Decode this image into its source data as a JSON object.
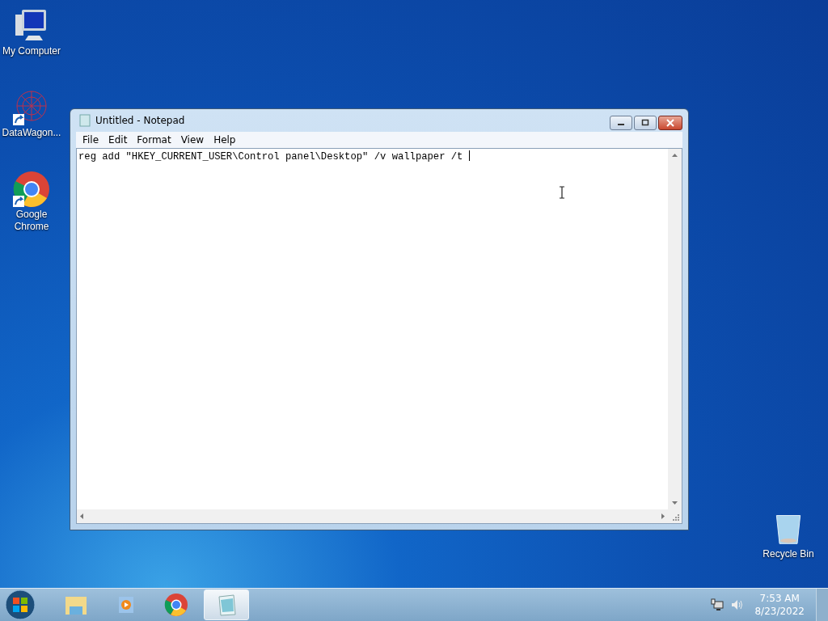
{
  "desktop_icons": [
    {
      "label": "My Computer",
      "kind": "computer",
      "shortcut": false
    },
    {
      "label": "DataWagon...",
      "kind": "network",
      "shortcut": true
    },
    {
      "label": "Google Chrome",
      "kind": "chrome",
      "shortcut": true
    }
  ],
  "recycle_bin": {
    "label": "Recycle Bin"
  },
  "window": {
    "title": "Untitled - Notepad",
    "menu": [
      "File",
      "Edit",
      "Format",
      "View",
      "Help"
    ],
    "text": "reg add \"HKEY_CURRENT_USER\\Control panel\\Desktop\" /v wallpaper /t "
  },
  "taskbar": {
    "items": [
      {
        "kind": "explorer",
        "selected": false
      },
      {
        "kind": "media",
        "selected": false
      },
      {
        "kind": "chrome",
        "selected": false
      },
      {
        "kind": "notepad",
        "selected": true
      }
    ],
    "time": "7:53 AM",
    "date": "8/23/2022"
  }
}
